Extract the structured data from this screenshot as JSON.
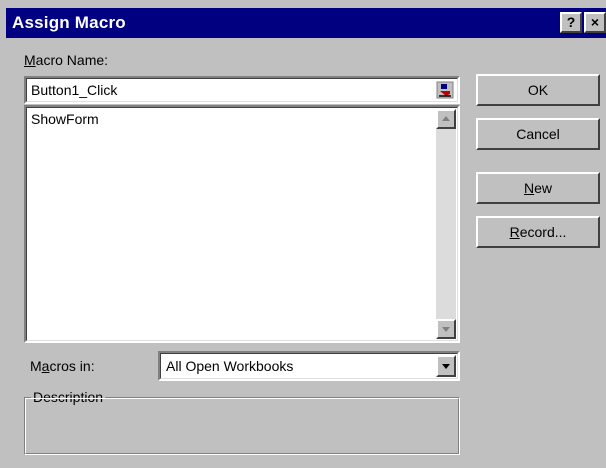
{
  "window": {
    "title": "Assign Macro",
    "help_glyph": "?",
    "close_glyph": "×",
    "title_bar_color": "#000080",
    "face_color": "#c0c0c0"
  },
  "macro_name": {
    "label_accel": "M",
    "label_rest": "acro Name:",
    "value": "Button1_Click",
    "picker_icon": "macro-picker-icon"
  },
  "macro_list": {
    "items": [
      "ShowForm"
    ]
  },
  "buttons": {
    "ok": "OK",
    "cancel": "Cancel",
    "new_accel": "N",
    "new_rest": "ew",
    "record_accel": "R",
    "record_rest": "ecord..."
  },
  "macros_in": {
    "label_pre": "M",
    "label_accel": "a",
    "label_rest": "cros in:",
    "selected": "All Open Workbooks"
  },
  "description": {
    "legend": "Description"
  }
}
